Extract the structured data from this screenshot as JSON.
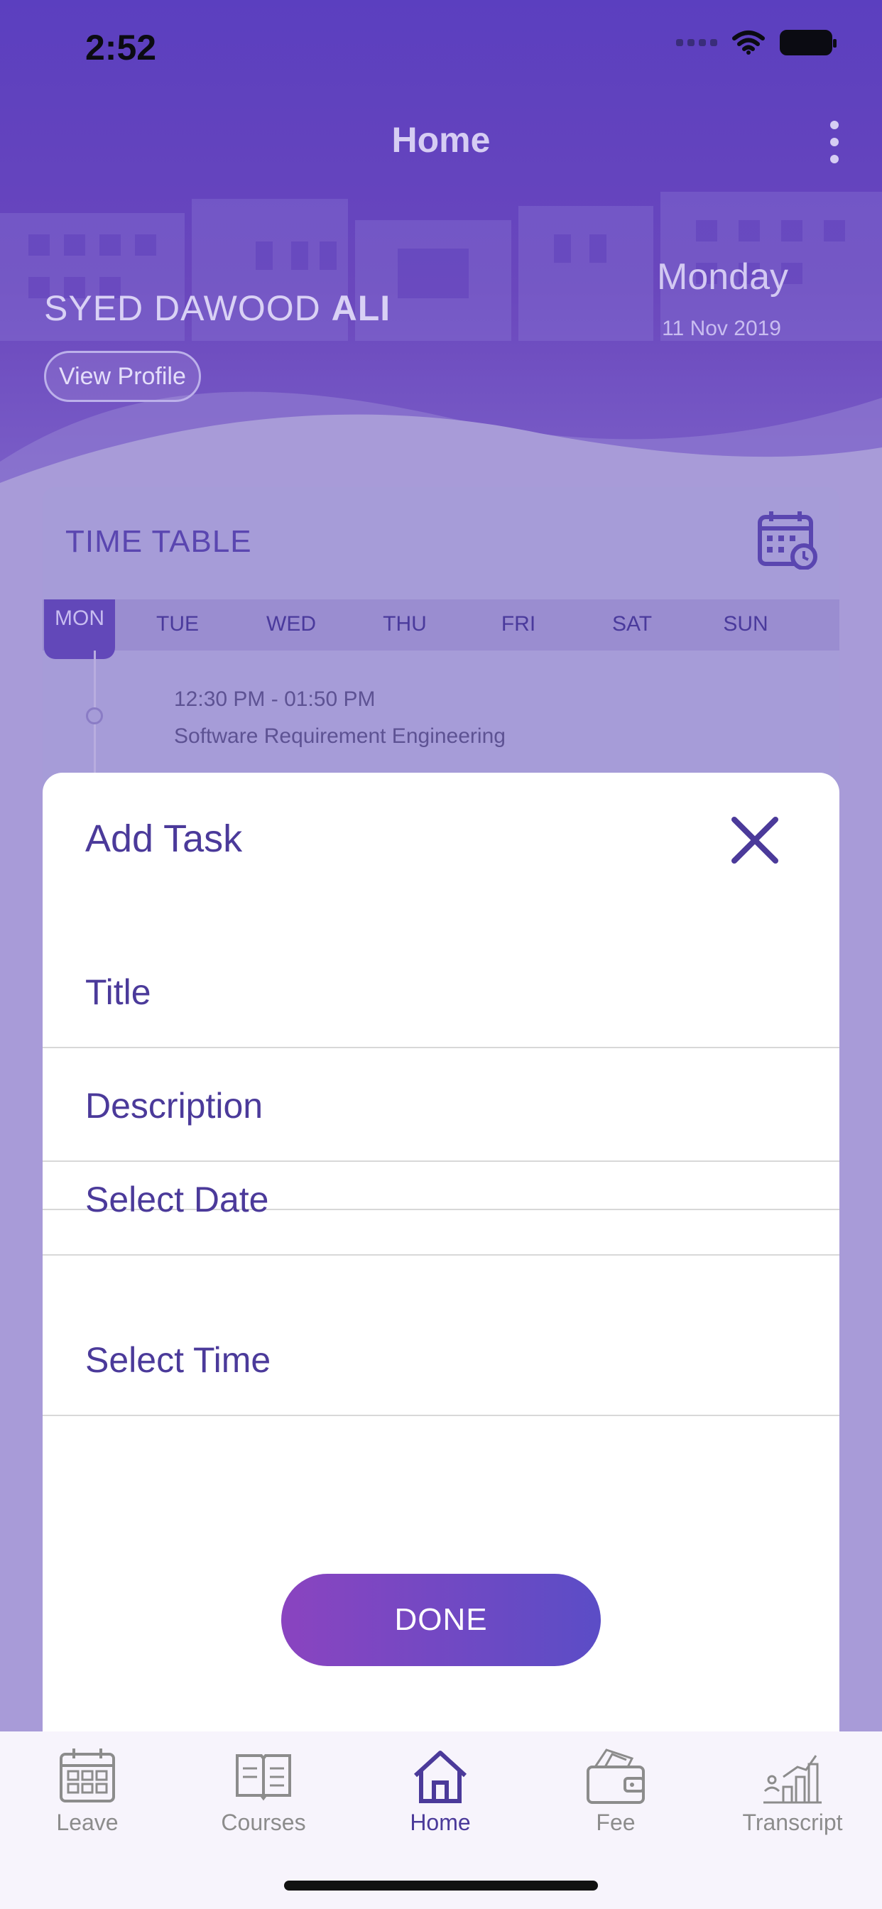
{
  "status_bar": {
    "time": "2:52"
  },
  "header": {
    "title": "Home",
    "user_first": "SYED DAWOOD",
    "user_last": "ALI",
    "view_profile_label": "View Profile",
    "day_name": "Monday",
    "date": "11 Nov 2019"
  },
  "timetable": {
    "title": "TIME TABLE",
    "days": [
      "MON",
      "TUE",
      "WED",
      "THU",
      "FRI",
      "SAT",
      "SUN"
    ],
    "active_day": "MON",
    "classes": [
      {
        "time": "12:30 PM - 01:50 PM",
        "name": "Software Requirement Engineering"
      }
    ]
  },
  "modal": {
    "title": "Add Task",
    "fields": {
      "title": "Title",
      "description": "Description",
      "date": "Select Date",
      "time": "Select Time"
    },
    "done_label": "DONE"
  },
  "tabbar": {
    "items": [
      {
        "label": "Leave",
        "icon": "calendar-icon"
      },
      {
        "label": "Courses",
        "icon": "book-icon"
      },
      {
        "label": "Home",
        "icon": "home-icon"
      },
      {
        "label": "Fee",
        "icon": "wallet-icon"
      },
      {
        "label": "Transcript",
        "icon": "chart-icon"
      }
    ],
    "active": "Home"
  },
  "colors": {
    "primary": "#5b3fbf",
    "accent": "#4b3a9a",
    "button_gradient_start": "#8a44c0",
    "button_gradient_end": "#5b4dc6"
  }
}
